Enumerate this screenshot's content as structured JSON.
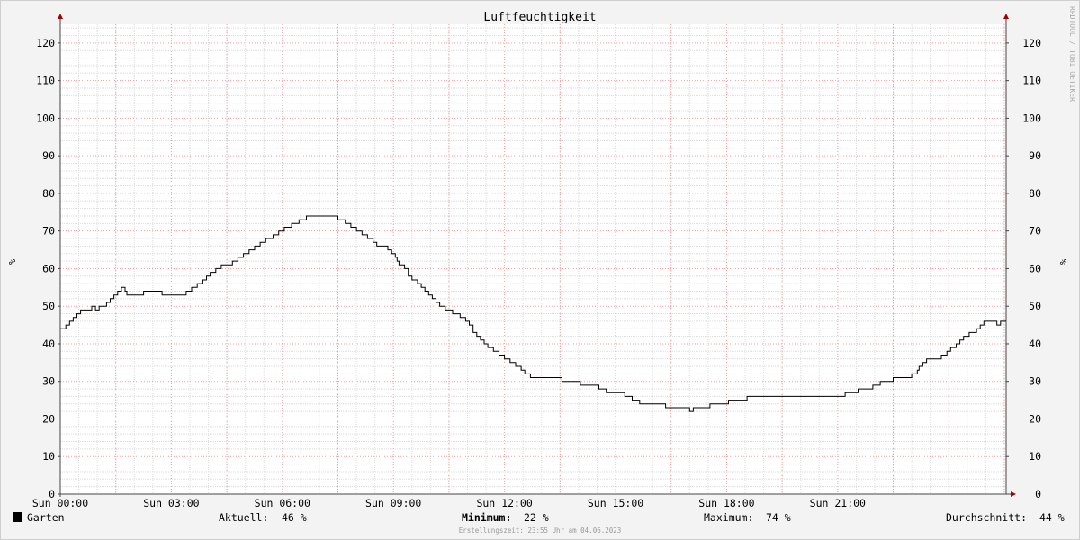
{
  "chart_data": {
    "type": "line",
    "title": "Luftfeuchtigkeit",
    "ylabel": "%",
    "y2label": "%",
    "watermark": "RRDTOOL / TOBI OETIKER",
    "ylim": [
      0,
      125
    ],
    "yticks": [
      0,
      10,
      20,
      30,
      40,
      50,
      60,
      70,
      80,
      90,
      100,
      110,
      120
    ],
    "xlim": [
      0,
      24
    ],
    "xticks": [
      {
        "x": 0,
        "label": "Sun 00:00"
      },
      {
        "x": 3,
        "label": "Sun 03:00"
      },
      {
        "x": 6,
        "label": "Sun 06:00"
      },
      {
        "x": 9,
        "label": "Sun 09:00"
      },
      {
        "x": 12,
        "label": "Sun 12:00"
      },
      {
        "x": 15,
        "label": "Sun 15:00"
      },
      {
        "x": 18,
        "label": "Sun 18:00"
      },
      {
        "x": 21,
        "label": "Sun 21:00"
      }
    ],
    "grid": true,
    "series": [
      {
        "name": "Garten",
        "color": "#000000",
        "step": true,
        "points": [
          [
            0.0,
            44
          ],
          [
            0.15,
            45
          ],
          [
            0.25,
            46
          ],
          [
            0.35,
            47
          ],
          [
            0.45,
            48
          ],
          [
            0.55,
            49
          ],
          [
            0.75,
            49
          ],
          [
            0.85,
            50
          ],
          [
            0.95,
            49
          ],
          [
            1.05,
            50
          ],
          [
            1.15,
            50
          ],
          [
            1.25,
            51
          ],
          [
            1.35,
            52
          ],
          [
            1.45,
            53
          ],
          [
            1.55,
            54
          ],
          [
            1.65,
            55
          ],
          [
            1.75,
            54
          ],
          [
            1.8,
            53
          ],
          [
            1.95,
            53
          ],
          [
            2.1,
            53
          ],
          [
            2.25,
            54
          ],
          [
            2.45,
            54
          ],
          [
            2.6,
            54
          ],
          [
            2.75,
            53
          ],
          [
            2.9,
            53
          ],
          [
            3.05,
            53
          ],
          [
            3.25,
            53
          ],
          [
            3.4,
            54
          ],
          [
            3.55,
            55
          ],
          [
            3.7,
            56
          ],
          [
            3.85,
            57
          ],
          [
            3.95,
            58
          ],
          [
            4.05,
            59
          ],
          [
            4.2,
            60
          ],
          [
            4.35,
            61
          ],
          [
            4.55,
            61
          ],
          [
            4.65,
            62
          ],
          [
            4.8,
            63
          ],
          [
            4.95,
            64
          ],
          [
            5.1,
            65
          ],
          [
            5.25,
            66
          ],
          [
            5.4,
            67
          ],
          [
            5.55,
            68
          ],
          [
            5.75,
            69
          ],
          [
            5.9,
            70
          ],
          [
            6.05,
            71
          ],
          [
            6.25,
            72
          ],
          [
            6.45,
            73
          ],
          [
            6.65,
            74
          ],
          [
            7.0,
            74
          ],
          [
            7.25,
            74
          ],
          [
            7.5,
            73
          ],
          [
            7.7,
            72
          ],
          [
            7.85,
            71
          ],
          [
            8.0,
            70
          ],
          [
            8.15,
            69
          ],
          [
            8.3,
            68
          ],
          [
            8.45,
            67
          ],
          [
            8.55,
            66
          ],
          [
            8.75,
            66
          ],
          [
            8.85,
            65
          ],
          [
            8.95,
            64
          ],
          [
            9.05,
            63
          ],
          [
            9.1,
            62
          ],
          [
            9.15,
            61
          ],
          [
            9.3,
            60
          ],
          [
            9.4,
            58
          ],
          [
            9.5,
            57
          ],
          [
            9.65,
            56
          ],
          [
            9.75,
            55
          ],
          [
            9.85,
            54
          ],
          [
            9.95,
            53
          ],
          [
            10.05,
            52
          ],
          [
            10.15,
            51
          ],
          [
            10.25,
            50
          ],
          [
            10.4,
            49
          ],
          [
            10.6,
            48
          ],
          [
            10.8,
            47
          ],
          [
            10.95,
            46
          ],
          [
            11.05,
            45
          ],
          [
            11.15,
            43
          ],
          [
            11.25,
            42
          ],
          [
            11.35,
            41
          ],
          [
            11.45,
            40
          ],
          [
            11.55,
            39
          ],
          [
            11.7,
            38
          ],
          [
            11.85,
            37
          ],
          [
            12.0,
            36
          ],
          [
            12.15,
            35
          ],
          [
            12.3,
            34
          ],
          [
            12.45,
            33
          ],
          [
            12.55,
            32
          ],
          [
            12.7,
            31
          ],
          [
            13.0,
            31
          ],
          [
            13.35,
            31
          ],
          [
            13.55,
            30
          ],
          [
            13.75,
            30
          ],
          [
            13.95,
            30
          ],
          [
            14.05,
            29
          ],
          [
            14.35,
            29
          ],
          [
            14.55,
            28
          ],
          [
            14.75,
            27
          ],
          [
            15.15,
            27
          ],
          [
            15.25,
            26
          ],
          [
            15.45,
            25
          ],
          [
            15.65,
            24
          ],
          [
            16.05,
            24
          ],
          [
            16.35,
            23
          ],
          [
            16.6,
            23
          ],
          [
            16.95,
            23
          ],
          [
            17.0,
            22
          ],
          [
            17.1,
            23
          ],
          [
            17.45,
            23
          ],
          [
            17.55,
            24
          ],
          [
            17.95,
            24
          ],
          [
            18.05,
            25
          ],
          [
            18.45,
            25
          ],
          [
            18.55,
            26
          ],
          [
            19.0,
            26
          ],
          [
            19.75,
            26
          ],
          [
            20.7,
            26
          ],
          [
            21.1,
            26
          ],
          [
            21.2,
            27
          ],
          [
            21.5,
            27
          ],
          [
            21.55,
            28
          ],
          [
            21.8,
            28
          ],
          [
            21.95,
            29
          ],
          [
            22.15,
            30
          ],
          [
            22.4,
            30
          ],
          [
            22.5,
            31
          ],
          [
            22.9,
            31
          ],
          [
            23.0,
            32
          ],
          [
            23.15,
            33
          ],
          [
            23.2,
            34
          ],
          [
            23.3,
            35
          ],
          [
            23.4,
            36
          ],
          [
            23.65,
            36
          ],
          [
            23.8,
            37
          ],
          [
            23.95,
            38
          ],
          [
            24.05,
            39
          ],
          [
            24.2,
            40
          ],
          [
            24.3,
            41
          ],
          [
            24.4,
            42
          ],
          [
            24.55,
            43
          ],
          [
            24.75,
            44
          ],
          [
            24.85,
            45
          ],
          [
            24.95,
            46
          ],
          [
            25.25,
            46
          ],
          [
            25.3,
            45
          ],
          [
            25.4,
            46
          ],
          [
            25.55,
            46
          ]
        ]
      }
    ]
  },
  "legend": {
    "swatch_color": "#000000",
    "series_name": "Garten",
    "current_label": "Aktuell:",
    "current_value": "46 %",
    "min_label": "Minimum:",
    "min_value": "22 %",
    "max_label": "Maximum:",
    "max_value": "74 %",
    "avg_label": "Durchschnitt:",
    "avg_value": "44 %"
  },
  "footer": {
    "created": "Erstellungszeit: 23:55 Uhr am 04.06.2023"
  },
  "colors": {
    "background": "#f3f3f3",
    "plot_background": "#ffffff",
    "minor_grid": "#dddddd",
    "major_grid": "#f0a0a0",
    "axis": "#444444",
    "arrow": "#a00000"
  }
}
